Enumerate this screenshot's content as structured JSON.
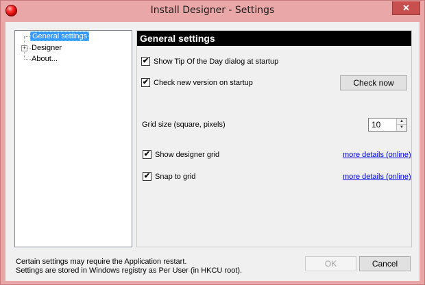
{
  "window": {
    "title": "Install Designer - Settings",
    "close_glyph": "✕",
    "app_icon": "red-ball-icon"
  },
  "tree": {
    "items": [
      {
        "label": "General settings",
        "selected": true
      },
      {
        "label": "Designer",
        "expandable": true
      },
      {
        "label": "About..."
      }
    ],
    "expander_glyph": "+"
  },
  "panel": {
    "header": "General settings",
    "show_tip": {
      "label": "Show Tip Of the Day dialog at startup",
      "checked": true
    },
    "check_version": {
      "label": "Check new version on startup",
      "checked": true
    },
    "check_now_label": "Check now",
    "grid_size": {
      "label": "Grid size (square,  pixels)",
      "value": "10"
    },
    "show_grid": {
      "label": "Show designer grid",
      "checked": true,
      "link": "more details (online)"
    },
    "snap_grid": {
      "label": "Snap to grid",
      "checked": true,
      "link": "more details (online)"
    }
  },
  "footer": {
    "note_line1": "Certain settings may require the Application restart.",
    "note_line2": "Settings are stored in Windows registry as Per User (in HKCU root).",
    "ok_label": "OK",
    "cancel_label": "Cancel"
  },
  "colors": {
    "title_bar": "#eaa7a7",
    "close_button": "#c7504f",
    "selection": "#3399ff",
    "link": "#0000ee",
    "header_bg": "#000000"
  }
}
